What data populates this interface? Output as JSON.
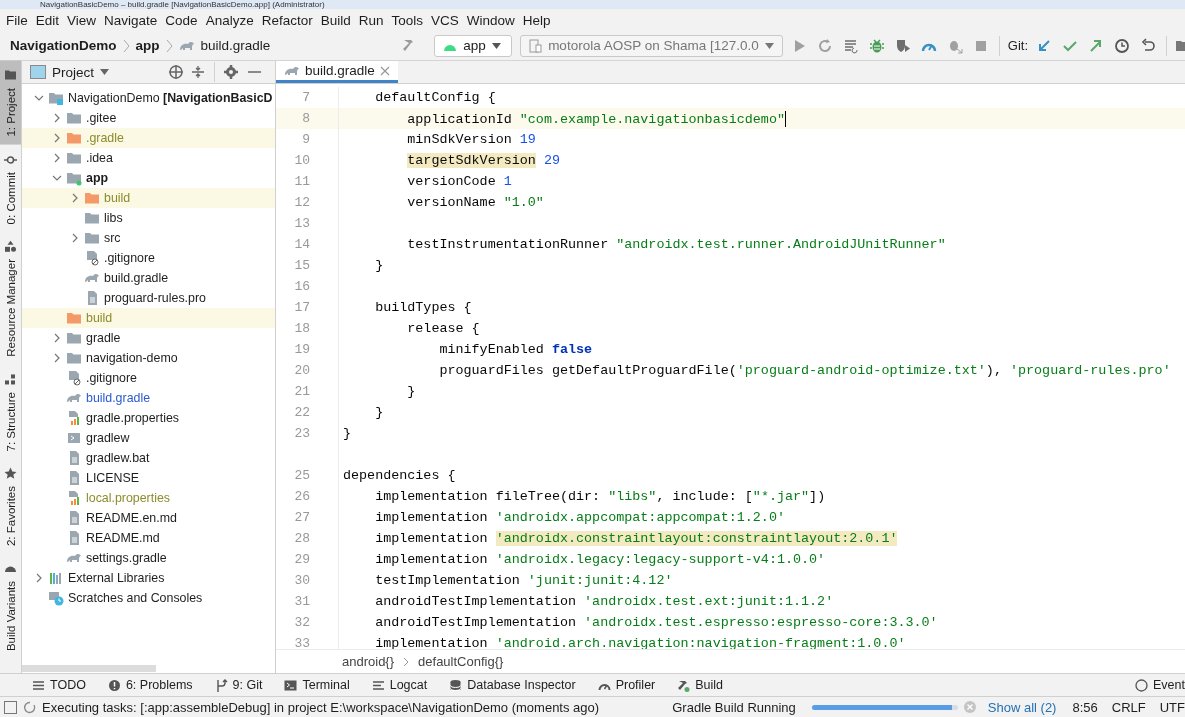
{
  "window": {
    "title": "NavigationBasicDemo – build.gradle [NavigationBasicDemo.app] (Administrator)"
  },
  "menu": [
    "File",
    "Edit",
    "View",
    "Navigate",
    "Code",
    "Analyze",
    "Refactor",
    "Build",
    "Run",
    "Tools",
    "VCS",
    "Window",
    "Help"
  ],
  "navbar": {
    "breadcrumbs": [
      {
        "label": "NavigationDemo",
        "kind": "project"
      },
      {
        "label": "app",
        "kind": "module"
      },
      {
        "label": "build.gradle",
        "kind": "gradle"
      }
    ],
    "config": "app",
    "device": "motorola AOSP on Shama [127.0.0",
    "actions": [
      {
        "kind": "run",
        "disabled": true
      },
      {
        "kind": "rerun",
        "disabled": true
      },
      {
        "kind": "apply",
        "disabled": false
      },
      {
        "kind": "debug",
        "disabled": false
      },
      {
        "kind": "coverage",
        "disabled": false
      },
      {
        "kind": "profile",
        "disabled": false
      },
      {
        "kind": "attach",
        "disabled": true
      },
      {
        "kind": "stop",
        "disabled": true
      }
    ],
    "git_label": "Git:"
  },
  "tool_strip": [
    {
      "label": "1: Project",
      "kind": "folder",
      "selected": true
    },
    {
      "label": "0: Commit",
      "kind": "commit",
      "selected": false
    },
    {
      "label": "Resource Manager",
      "kind": "resources",
      "selected": false
    },
    {
      "label": "7: Structure",
      "kind": "structure",
      "selected": false
    },
    {
      "label": "2: Favorites",
      "kind": "star",
      "selected": false
    },
    {
      "label": "Build Variants",
      "kind": "android",
      "selected": false
    }
  ],
  "project_panel": {
    "title": "Project",
    "tree": [
      {
        "label": "NavigationDemo **[NavigationBasicD**",
        "kind": "project",
        "expanded": true,
        "ignored": false,
        "modified": false,
        "children": [
          {
            "label": ".gitee",
            "kind": "folder",
            "expanded": false,
            "ignored": false,
            "modified": false
          },
          {
            "label": ".gradle",
            "kind": "folder",
            "expanded": false,
            "ignored": true,
            "modified": false
          },
          {
            "label": ".idea",
            "kind": "folder",
            "expanded": false,
            "ignored": false,
            "modified": false
          },
          {
            "label": "app",
            "kind": "module",
            "expanded": true,
            "ignored": false,
            "modified": false,
            "children": [
              {
                "label": "build",
                "kind": "folder",
                "expanded": false,
                "ignored": true,
                "modified": false
              },
              {
                "label": "libs",
                "kind": "folder",
                "ignored": false,
                "modified": false
              },
              {
                "label": "src",
                "kind": "folder",
                "expanded": false,
                "ignored": false,
                "modified": false
              },
              {
                "label": ".gitignore",
                "kind": "ignore",
                "ignored": false,
                "modified": false
              },
              {
                "label": "build.gradle",
                "kind": "gradle",
                "ignored": false,
                "modified": false
              },
              {
                "label": "proguard-rules.pro",
                "kind": "text",
                "ignored": false,
                "modified": false
              }
            ]
          },
          {
            "label": "build",
            "kind": "folder",
            "ignored": true,
            "modified": false
          },
          {
            "label": "gradle",
            "kind": "folder",
            "expanded": false,
            "ignored": false,
            "modified": false
          },
          {
            "label": "navigation-demo",
            "kind": "folder",
            "expanded": false,
            "ignored": false,
            "modified": false
          },
          {
            "label": ".gitignore",
            "kind": "ignore",
            "ignored": false,
            "modified": false
          },
          {
            "label": "build.gradle",
            "kind": "gradle",
            "ignored": false,
            "modified": true
          },
          {
            "label": "gradle.properties",
            "kind": "properties",
            "ignored": false,
            "modified": false
          },
          {
            "label": "gradlew",
            "kind": "script",
            "ignored": false,
            "modified": false
          },
          {
            "label": "gradlew.bat",
            "kind": "text",
            "ignored": false,
            "modified": false
          },
          {
            "label": "LICENSE",
            "kind": "text",
            "ignored": false,
            "modified": false
          },
          {
            "label": "local.properties",
            "kind": "properties",
            "ignored": true,
            "modified": false
          },
          {
            "label": "README.en.md",
            "kind": "text",
            "ignored": false,
            "modified": false
          },
          {
            "label": "README.md",
            "kind": "text",
            "ignored": false,
            "modified": false
          },
          {
            "label": "settings.gradle",
            "kind": "gradle",
            "ignored": false,
            "modified": false
          }
        ]
      },
      {
        "label": "External Libraries",
        "kind": "libraries",
        "expanded": false,
        "ignored": false,
        "modified": false
      },
      {
        "label": "Scratches and Consoles",
        "kind": "scratches",
        "ignored": false,
        "modified": false
      }
    ]
  },
  "editor": {
    "tabs": [
      {
        "label": "build.gradle",
        "selected": true
      }
    ],
    "lines": [
      {
        "number": "7",
        "current": false,
        "segments": [
          {
            "text": "    defaultConfig {",
            "kind": "plain"
          }
        ]
      },
      {
        "number": "8",
        "current": true,
        "segments": [
          {
            "text": "        applicationId ",
            "kind": "plain"
          },
          {
            "text": "\"com.example.navigationbasicdemo\"",
            "kind": "string"
          }
        ]
      },
      {
        "number": "9",
        "current": false,
        "segments": [
          {
            "text": "        minSdkVersion ",
            "kind": "plain"
          },
          {
            "text": "19",
            "kind": "number"
          }
        ]
      },
      {
        "number": "10",
        "current": false,
        "segments": [
          {
            "text": "        targetSdkVersion",
            "kind": "plain_marked"
          },
          {
            "text": " 29",
            "kind": "number"
          }
        ]
      },
      {
        "number": "11",
        "current": false,
        "segments": [
          {
            "text": "        versionCode ",
            "kind": "plain"
          },
          {
            "text": "1",
            "kind": "number"
          }
        ]
      },
      {
        "number": "12",
        "current": false,
        "segments": [
          {
            "text": "        versionName ",
            "kind": "plain"
          },
          {
            "text": "\"1.0\"",
            "kind": "string"
          }
        ]
      },
      {
        "number": "13",
        "current": false
      },
      {
        "number": "14",
        "current": false,
        "segments": [
          {
            "text": "        testInstrumentationRunner ",
            "kind": "plain"
          },
          {
            "text": "\"androidx.test.runner.AndroidJUnitRunner\"",
            "kind": "string"
          }
        ]
      },
      {
        "number": "15",
        "current": false,
        "segments": [
          {
            "text": "    }",
            "kind": "plain"
          }
        ]
      },
      {
        "number": "16",
        "current": false
      },
      {
        "number": "17",
        "current": false,
        "segments": [
          {
            "text": "    buildTypes {",
            "kind": "plain"
          }
        ]
      },
      {
        "number": "18",
        "current": false,
        "segments": [
          {
            "text": "        release {",
            "kind": "plain"
          }
        ]
      },
      {
        "number": "19",
        "current": false,
        "segments": [
          {
            "text": "            minifyEnabled ",
            "kind": "plain"
          },
          {
            "text": "false",
            "kind": "keyword"
          }
        ]
      },
      {
        "number": "20",
        "current": false,
        "segments": [
          {
            "text": "            proguardFiles getDefaultProguardFile(",
            "kind": "plain"
          },
          {
            "text": "'proguard-android-optimize.txt'",
            "kind": "string"
          },
          {
            "text": "), ",
            "kind": "plain"
          },
          {
            "text": "'proguard-rules.pro'",
            "kind": "string"
          }
        ]
      },
      {
        "number": "21",
        "current": false,
        "segments": [
          {
            "text": "        }",
            "kind": "plain"
          }
        ]
      },
      {
        "number": "22",
        "current": false,
        "segments": [
          {
            "text": "    }",
            "kind": "plain"
          }
        ]
      },
      {
        "number": "23",
        "current": false,
        "segments": [
          {
            "text": "}",
            "kind": "plain"
          }
        ]
      },
      {
        "current": false
      },
      {
        "number": "25",
        "current": false,
        "segments": [
          {
            "text": "dependencies {",
            "kind": "plain"
          }
        ]
      },
      {
        "number": "26",
        "current": false,
        "segments": [
          {
            "text": "    implementation fileTree(dir: ",
            "kind": "plain"
          },
          {
            "text": "\"libs\"",
            "kind": "string"
          },
          {
            "text": ", include: [",
            "kind": "plain"
          },
          {
            "text": "\"*.jar\"",
            "kind": "string"
          },
          {
            "text": "])",
            "kind": "plain"
          }
        ]
      },
      {
        "number": "27",
        "current": false,
        "segments": [
          {
            "text": "    implementation ",
            "kind": "plain"
          },
          {
            "text": "'androidx.appcompat:appcompat:1.2.0'",
            "kind": "string"
          }
        ]
      },
      {
        "number": "28",
        "current": false,
        "segments": [
          {
            "text": "    implementation ",
            "kind": "plain"
          },
          {
            "text": "'androidx.constraintlayout:constraintlayout:2.0.1'",
            "kind": "string_marked"
          }
        ]
      },
      {
        "number": "29",
        "current": false,
        "segments": [
          {
            "text": "    implementation ",
            "kind": "plain"
          },
          {
            "text": "'androidx.legacy:legacy-support-v4:1.0.0'",
            "kind": "string"
          }
        ]
      },
      {
        "number": "30",
        "current": false,
        "segments": [
          {
            "text": "    testImplementation ",
            "kind": "plain"
          },
          {
            "text": "'junit:junit:4.12'",
            "kind": "string"
          }
        ]
      },
      {
        "number": "31",
        "current": false,
        "segments": [
          {
            "text": "    androidTestImplementation ",
            "kind": "plain"
          },
          {
            "text": "'androidx.test.ext:junit:1.1.2'",
            "kind": "string"
          }
        ]
      },
      {
        "number": "32",
        "current": false,
        "segments": [
          {
            "text": "    androidTestImplementation ",
            "kind": "plain"
          },
          {
            "text": "'androidx.test.espresso:espresso-core:3.3.0'",
            "kind": "string"
          }
        ]
      },
      {
        "number": "33",
        "current": false,
        "segments": [
          {
            "text": "    implementation ",
            "kind": "plain"
          },
          {
            "text": "'android.arch.navigation:navigation-fragment:1.0.0'",
            "kind": "string"
          }
        ]
      }
    ],
    "breadcrumbs": [
      "android{}",
      "defaultConfig{}"
    ]
  },
  "bottom_tools": [
    {
      "label": "TODO",
      "kind": "list"
    },
    {
      "label": "6: Problems",
      "kind": "problems"
    },
    {
      "label": "9: Git",
      "kind": "git"
    },
    {
      "label": "Terminal",
      "kind": "terminal"
    },
    {
      "label": "Logcat",
      "kind": "logcat"
    },
    {
      "label": "Database Inspector",
      "kind": "database"
    },
    {
      "label": "Profiler",
      "kind": "profiler"
    },
    {
      "label": "Build",
      "kind": "build"
    }
  ],
  "event_log": "Event",
  "status_bar": {
    "message": "Executing tasks: [:app:assembleDebug] in project E:\\workspace\\NavigationDemo (moments ago)",
    "task": "Gradle Build Running",
    "level": 0.96,
    "show_all": "Show all (2)",
    "position": "8:56",
    "line_ending": "CRLF",
    "encoding": "UTF"
  }
}
